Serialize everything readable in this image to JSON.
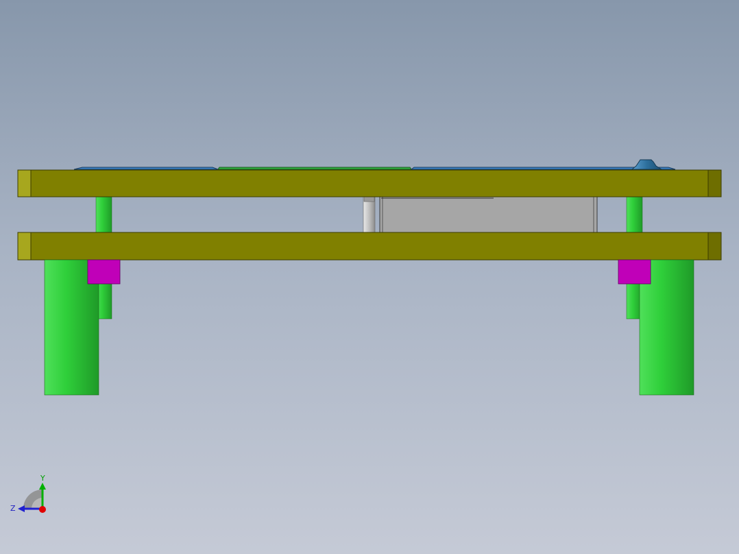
{
  "viewport": {
    "background_top": "#8797ab",
    "background_bottom": "#c5cad6"
  },
  "colors": {
    "plate": "#808000",
    "plate_end": "#a7a71e",
    "guide_pillar": "#2fcf3a",
    "guide_pillar_dark": "#25a12c",
    "bushing": "#c000b8",
    "insert_block": "#a6a6a6",
    "punch_pin": "#c8c8c8",
    "top_part": "#3b82c4",
    "top_part_green": "#30b040",
    "knob": "#2d6f9c"
  },
  "triad": {
    "y_label": "Y",
    "z_label": "Z",
    "y_color": "#00b000",
    "z_color": "#2020d0",
    "x_color": "#e00000"
  }
}
